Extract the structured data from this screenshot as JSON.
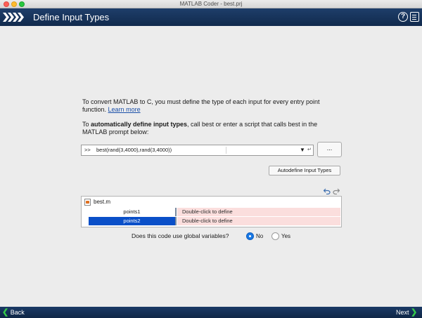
{
  "window": {
    "title": "MATLAB Coder - best.prj"
  },
  "header": {
    "title": "Define Input Types",
    "help_glyph": "?",
    "icons": [
      "chevrons-icon",
      "help-icon",
      "menu-icon"
    ]
  },
  "intro": {
    "text": "To convert MATLAB to C, you must define the type of each input for every entry point function.",
    "link": "Learn more"
  },
  "auto_define": {
    "prefix": "To ",
    "bold": "automatically define input types",
    "suffix": ", call best or enter a script that calls best in the MATLAB prompt below:"
  },
  "command": {
    "prompt": ">>",
    "value": "best(rand(3,4000),rand(3,4000))",
    "dropdown_glyph": "▼",
    "enter_glyph": "↵",
    "browse_label": "..."
  },
  "autodefine_button": "Autodefine Input Types",
  "entry_points": {
    "file": "best.m",
    "inputs": [
      {
        "name": "points1",
        "type": "Double-click to define",
        "selected": false
      },
      {
        "name": "points2",
        "type": "Double-click to define",
        "selected": true
      }
    ]
  },
  "globals": {
    "question": "Does this code use global variables?",
    "options": [
      "No",
      "Yes"
    ],
    "selected": "No"
  },
  "footer": {
    "back": "Back",
    "next": "Next",
    "back_glyph": "❮",
    "next_glyph": "❯"
  },
  "colors": {
    "header": "#1e3e6a",
    "selection": "#0a4fc8",
    "undefined_type": "#fbdedd",
    "radio": "#1878e4"
  }
}
